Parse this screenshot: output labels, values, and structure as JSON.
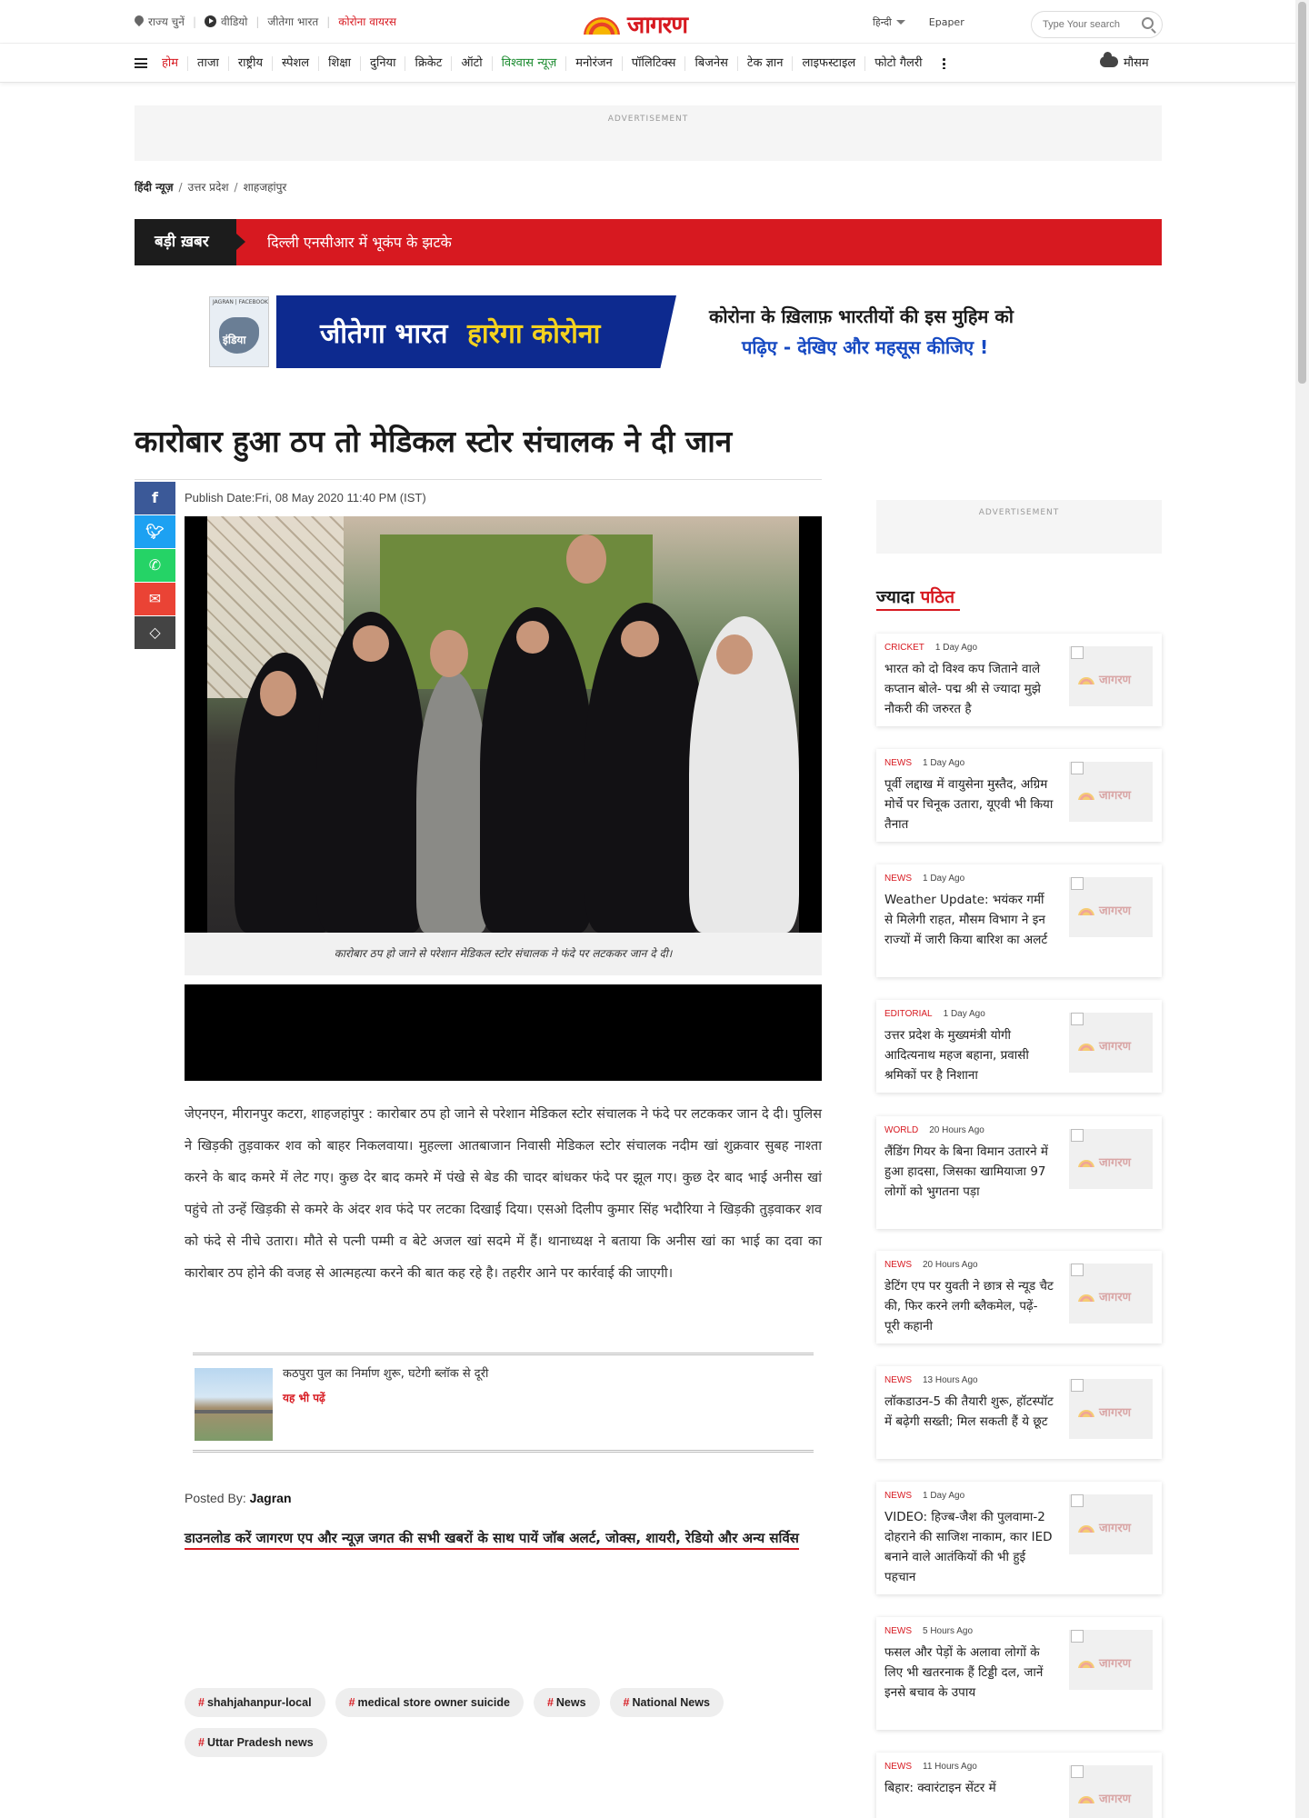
{
  "top": {
    "state": "राज्य चुनें",
    "video": "वीडियो",
    "jeetega": "जीतेगा भारत",
    "corona": "कोरोना वायरस",
    "logo": "जागरण",
    "lang": "हिन्दी",
    "epaper": "Epaper",
    "search_placeholder": "Type Your search"
  },
  "nav": {
    "items": [
      "होम",
      "ताजा",
      "राष्ट्रीय",
      "स्पेशल",
      "शिक्षा",
      "दुनिया",
      "क्रिकेट",
      "ऑटो",
      "विश्वास न्यूज़",
      "मनोरंजन",
      "पॉलिटिक्स",
      "बिजनेस",
      "टेक ज्ञान",
      "लाइफस्टाइल",
      "फोटो गैलरी"
    ],
    "weather": "मौसम"
  },
  "ad_label": "ADVERTISEMENT",
  "breadcrumb": {
    "c1": "हिंदी न्यूज़",
    "c2": "उत्तर प्रदेश",
    "c3": "शाहजहांपुर"
  },
  "breaking": {
    "label": "बड़ी ख़बर",
    "text": "दिल्ली एनसीआर में भूकंप के झटके"
  },
  "banner": {
    "small_top": "JAGRAN | FACEBOOK",
    "india": "इंडिया",
    "w1": "जीतेगा भारत",
    "w2": "हारेगा कोरोना",
    "r1": "कोरोना के ख़िलाफ़ भारतीयों की इस मुहिम को",
    "r2": "पढ़िए - देखिए और महसूस कीजिए !"
  },
  "article": {
    "headline": "कारोबार हुआ ठप तो मेडिकल स्टोर संचालक ने दी जान",
    "publish": "Publish Date:Fri, 08 May 2020 11:40 PM (IST)",
    "caption": "कारोबार ठप हो जाने से परेशान मेडिकल स्टोर संचालक ने फंदे पर लटककर जान दे दी।",
    "body": "जेएनएन, मीरानपुर कटरा, शाहजहांपुर : कारोबार ठप हो जाने से परेशान मेडिकल स्टोर संचालक ने फंदे पर लटककर जान दे दी। पुलिस ने खिड़की तुड़वाकर शव को बाहर निकलवाया। मुहल्ला आतबाजान निवासी मेडिकल स्टोर संचालक नदीम खां शुक्रवार सुबह नाश्ता करने के बाद कमरे में लेट गए। कुछ देर बाद कमरे में पंखे से बेड की चादर बांधकर फंदे पर झूल गए। कुछ देर बाद भाई अनीस खां पहुंचे तो उन्हें खिड़की से कमरे के अंदर शव फंदे पर लटका दिखाई दिया। एसओ दिलीप कुमार सिंह भदौरिया ने खिड़की तुड़वाकर शव को फंदे से नीचे उतारा। मौते से पत्नी पम्मी व बेटे अजल खां सदमे में हैं। थानाध्यक्ष ने बताया कि अनीस खां का भाई का दवा का कारोबार ठप होने की वजह से आत्महत्या करने की बात कह रहे है। तहरीर आने पर कार्रवाई की जाएगी।",
    "also_title": "कठपुरा पुल का निर्माण शुरू, घटेगी ब्लॉक से दूरी",
    "also_more": "यह भी पढ़ें",
    "posted_label": "Posted By:",
    "posted_by": "Jagran",
    "download": "डाउनलोड करें जागरण एप और न्यूज़ जगत की सभी खबरों के साथ पायें जॉब अलर्ट, जोक्स, शायरी, रेडियो और अन्य सर्विस",
    "tags": [
      "shahjahanpur-local",
      "medical store owner suicide",
      "News",
      "National News",
      "Uttar Pradesh news"
    ]
  },
  "sidebar": {
    "heading_a": "ज्यादा",
    "heading_b": "पठित",
    "thumb_logo": "जागरण",
    "cards": [
      {
        "cat": "CRICKET",
        "time": "1 Day Ago",
        "title": "भारत को दो विश्व कप जिताने वाले कप्तान बोले- पद्म श्री से ज्यादा मुझे नौकरी की जरुरत है"
      },
      {
        "cat": "NEWS",
        "time": "1 Day Ago",
        "title": "पूर्वी लद्दाख में वायुसेना मुस्तैद, अग्रिम मोर्चे पर चिनूक उतारा, यूएवी भी किया तैनात"
      },
      {
        "cat": "NEWS",
        "time": "1 Day Ago",
        "title": "Weather Update: भयंकर गर्मी से मिलेगी राहत, मौसम विभाग ने इन राज्यों में जारी किया बारिश का अलर्ट"
      },
      {
        "cat": "EDITORIAL",
        "time": "1 Day Ago",
        "title": "उत्तर प्रदेश के मुख्यमंत्री योगी आदित्यनाथ महज बहाना, प्रवासी श्रमिकों पर है निशाना"
      },
      {
        "cat": "WORLD",
        "time": "20 Hours Ago",
        "title": "लैंडिंग गियर के बिना विमान उतारने में हुआ हादसा, जिसका खामियाजा 97 लोगों को भुगतना पड़ा"
      },
      {
        "cat": "NEWS",
        "time": "20 Hours Ago",
        "title": "डेटिंग एप पर युवती ने छात्र से न्यूड चैट की, फिर करने लगी ब्लैकमेल, पढ़ें- पूरी कहानी"
      },
      {
        "cat": "NEWS",
        "time": "13 Hours Ago",
        "title": "लॉकडाउन-5 की तैयारी शुरू, हॉटस्पॉट में बढ़ेगी सख्ती; मिल सकती हैं ये छूट"
      },
      {
        "cat": "NEWS",
        "time": "1 Day Ago",
        "title": "VIDEO: हिज्ब-जैश की पुलवामा-2 दोहराने की साजिश नाकाम, कार IED बनाने वाले आतंकियों की भी हुई पहचान"
      },
      {
        "cat": "NEWS",
        "time": "5 Hours Ago",
        "title": "फसल और पेड़ों के अलावा लोगों के लिए भी खतरनाक हैं टिड्डी दल, जानें इनसे बचाव के उपाय"
      },
      {
        "cat": "NEWS",
        "time": "11 Hours Ago",
        "title": "बिहार: क्वारंटाइन सेंटर में"
      }
    ]
  }
}
